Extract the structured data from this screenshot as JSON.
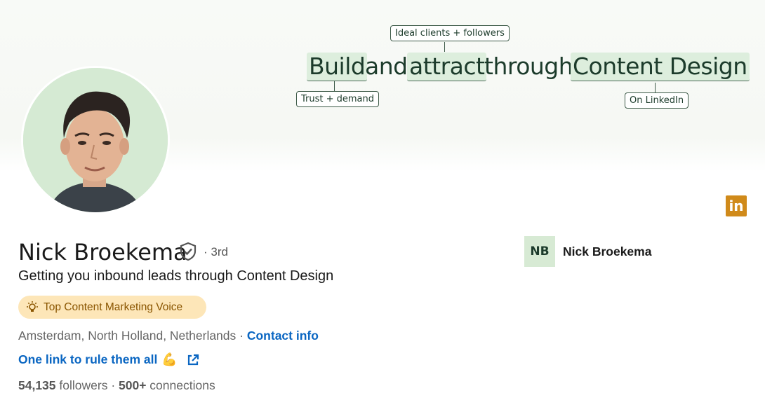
{
  "banner": {
    "words": [
      "Build",
      "and",
      "attract",
      "through",
      "Content Design"
    ],
    "tag_top": "Ideal clients + followers",
    "tag_left": "Trust + demand",
    "tag_right": "On LinkedIn"
  },
  "profile": {
    "name": "Nick Broekema",
    "degree": "· 3rd",
    "headline": "Getting you inbound leads through Content Design",
    "voice_badge": "Top Content Marketing Voice",
    "location": "Amsterdam, North Holland, Netherlands",
    "location_sep": " · ",
    "contact_info": "Contact info",
    "link_text": "One link to rule them all",
    "link_emoji": "💪",
    "followers_count": "54,135",
    "followers_label": " followers",
    "stats_sep": "  · ",
    "connections": "500+",
    "connections_label": " connections"
  },
  "company": {
    "logo_text": "NB",
    "name": "Nick Broekema"
  },
  "linkedin_badge": "in",
  "colors": {
    "link_blue": "#0a66c2",
    "badge_bg": "#fde6b8",
    "banner_highlight": "#ddeedd",
    "linkedin_orange": "#d08a1a"
  }
}
